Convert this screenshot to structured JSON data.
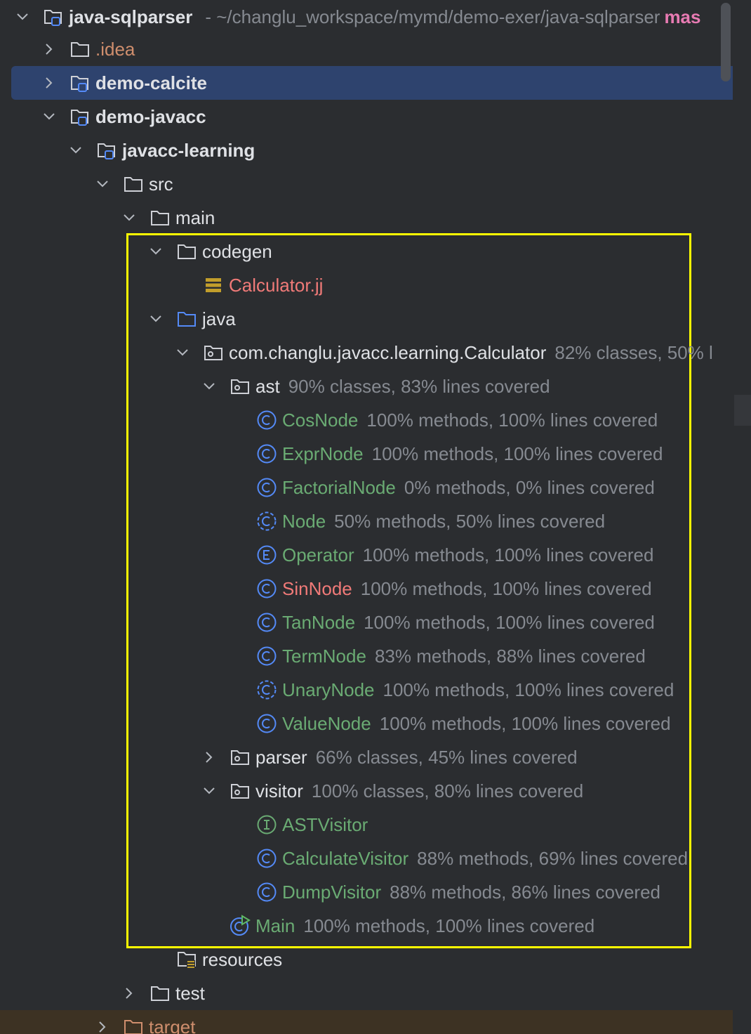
{
  "project": {
    "name": "java-sqlparser",
    "path": "- ~/changlu_workspace/mymd/demo-exer/java-sqlparser",
    "branch": "mas"
  },
  "rows": {
    "idea": ".idea",
    "demo_calcite": "demo-calcite",
    "demo_javacc": "demo-javacc",
    "javacc_learning": "javacc-learning",
    "src": "src",
    "main": "main",
    "codegen": "codegen",
    "calculator_jj": "Calculator.jj",
    "java": "java",
    "package": {
      "label": "com.changlu.javacc.learning.Calculator",
      "coverage": "82% classes, 50% l"
    },
    "ast": {
      "label": "ast",
      "coverage": "90% classes, 83% lines covered"
    },
    "ast_items": [
      {
        "label": "CosNode",
        "coverage": "100% methods, 100% lines covered",
        "icon": "class-icon"
      },
      {
        "label": "ExprNode",
        "coverage": "100% methods, 100% lines covered",
        "icon": "class-icon"
      },
      {
        "label": "FactorialNode",
        "coverage": "0% methods, 0% lines covered",
        "icon": "class-icon"
      },
      {
        "label": "Node",
        "coverage": "50% methods, 50% lines covered",
        "icon": "abstract-class-icon"
      },
      {
        "label": "Operator",
        "coverage": "100% methods, 100% lines covered",
        "icon": "enum-icon"
      },
      {
        "label": "SinNode",
        "coverage": "100% methods, 100% lines covered",
        "icon": "class-icon"
      },
      {
        "label": "TanNode",
        "coverage": "100% methods, 100% lines covered",
        "icon": "class-icon"
      },
      {
        "label": "TermNode",
        "coverage": "83% methods, 88% lines covered",
        "icon": "class-icon"
      },
      {
        "label": "UnaryNode",
        "coverage": "100% methods, 100% lines covered",
        "icon": "abstract-class-icon"
      },
      {
        "label": "ValueNode",
        "coverage": "100% methods, 100% lines covered",
        "icon": "class-icon"
      }
    ],
    "parser": {
      "label": "parser",
      "coverage": "66% classes, 45% lines covered"
    },
    "visitor": {
      "label": "visitor",
      "coverage": "100% classes, 80% lines covered"
    },
    "visitor_items": [
      {
        "label": "ASTVisitor",
        "coverage": "",
        "icon": "interface-icon"
      },
      {
        "label": "CalculateVisitor",
        "coverage": "88% methods, 69% lines covered",
        "icon": "class-icon"
      },
      {
        "label": "DumpVisitor",
        "coverage": "88% methods, 86% lines covered",
        "icon": "class-icon"
      }
    ],
    "main_class": {
      "label": "Main",
      "coverage": "100% methods, 100% lines covered"
    },
    "resources": "resources",
    "test": "test",
    "target": "target"
  },
  "colors": {
    "background": "#2b2d30",
    "selection": "#2e436e",
    "highlight_box": "#ffff00",
    "green_text": "#6aab73",
    "red_text": "#f07a78",
    "orange_text": "#cf8e6d",
    "coverage_text": "#868a91",
    "class_icon": "#548af7"
  }
}
